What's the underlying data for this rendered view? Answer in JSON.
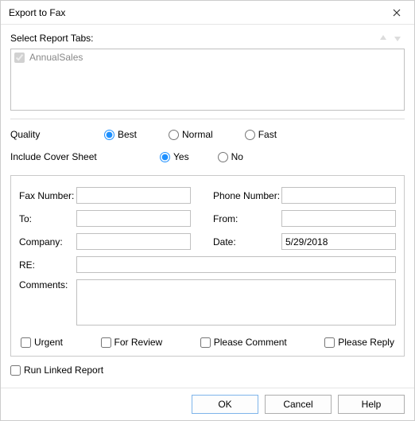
{
  "window": {
    "title": "Export to Fax"
  },
  "tabs": {
    "label": "Select Report Tabs:",
    "items": [
      {
        "label": "AnnualSales",
        "checked": true
      }
    ]
  },
  "quality": {
    "label": "Quality",
    "options": {
      "best": "Best",
      "normal": "Normal",
      "fast": "Fast"
    },
    "selected": "best"
  },
  "cover": {
    "label": "Include Cover Sheet",
    "options": {
      "yes": "Yes",
      "no": "No"
    },
    "selected": "yes"
  },
  "fields": {
    "fax_number": {
      "label": "Fax Number:",
      "value": ""
    },
    "phone_number": {
      "label": "Phone Number:",
      "value": ""
    },
    "to": {
      "label": "To:",
      "value": ""
    },
    "from": {
      "label": "From:",
      "value": ""
    },
    "company": {
      "label": "Company:",
      "value": ""
    },
    "date": {
      "label": "Date:",
      "value": "5/29/2018"
    },
    "re": {
      "label": "RE:",
      "value": ""
    },
    "comments": {
      "label": "Comments:",
      "value": ""
    }
  },
  "flags": {
    "urgent": "Urgent",
    "for_review": "For Review",
    "please_comment": "Please Comment",
    "please_reply": "Please Reply"
  },
  "linked": {
    "label": "Run Linked Report"
  },
  "buttons": {
    "ok": "OK",
    "cancel": "Cancel",
    "help": "Help"
  }
}
